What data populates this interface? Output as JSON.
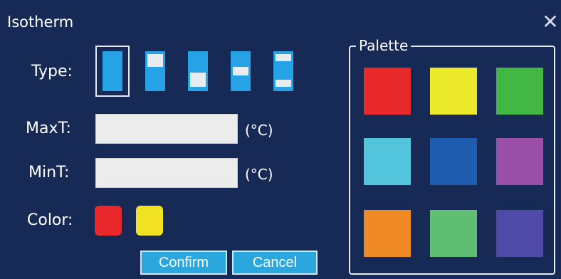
{
  "dialog": {
    "title": "Isotherm",
    "close_label": "✕"
  },
  "type": {
    "label": "Type:",
    "options": [
      {
        "name": "full",
        "selected": true
      },
      {
        "name": "top-band",
        "selected": false
      },
      {
        "name": "bottom-band",
        "selected": false
      },
      {
        "name": "middle-band",
        "selected": false
      },
      {
        "name": "top-bottom-bands",
        "selected": false
      }
    ]
  },
  "maxt": {
    "label": "MaxT:",
    "value": "",
    "unit": "(°C)"
  },
  "mint": {
    "label": "MinT:",
    "value": "",
    "unit": "(°C)"
  },
  "color": {
    "label": "Color:",
    "selected": [
      "#e8282b",
      "#f0e223"
    ]
  },
  "buttons": {
    "confirm": "Confirm",
    "cancel": "Cancel"
  },
  "palette": {
    "title": "Palette",
    "colors": [
      "#e8282b",
      "#ecea2a",
      "#43b743",
      "#52c5dc",
      "#1e5cb0",
      "#9a4fa8",
      "#f08a24",
      "#5fbe71",
      "#4f4aa8"
    ]
  },
  "theme": {
    "background": "#172a55",
    "accent": "#26a2e6"
  }
}
